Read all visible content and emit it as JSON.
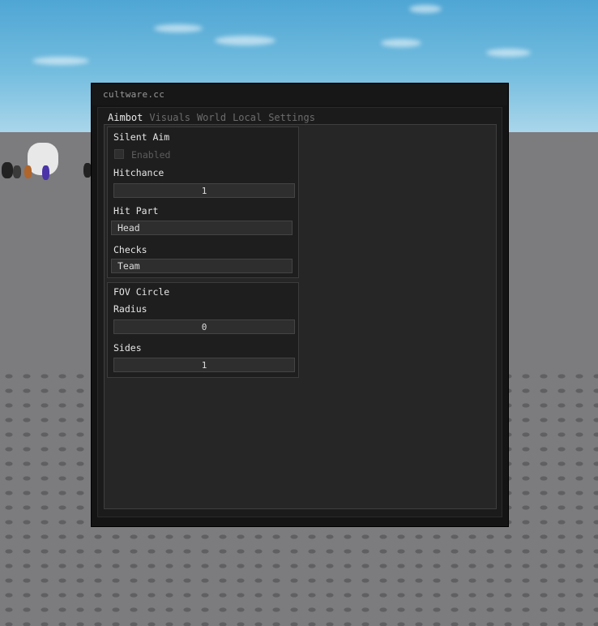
{
  "window": {
    "title": "cultware.cc"
  },
  "tabs": [
    {
      "label": "Aimbot",
      "active": true
    },
    {
      "label": "Visuals",
      "active": false
    },
    {
      "label": "World",
      "active": false
    },
    {
      "label": "Local",
      "active": false
    },
    {
      "label": "Settings",
      "active": false
    }
  ],
  "silent_aim": {
    "title": "Silent Aim",
    "enabled_label": "Enabled",
    "enabled": false,
    "hitchance_label": "Hitchance",
    "hitchance_value": "1",
    "hit_part_label": "Hit Part",
    "hit_part_value": "Head",
    "checks_label": "Checks",
    "checks_value": "Team"
  },
  "fov_circle": {
    "title": "FOV Circle",
    "radius_label": "Radius",
    "radius_value": "0",
    "sides_label": "Sides",
    "sides_value": "1"
  },
  "colors": {
    "accent_text": "#e6e6e6",
    "inactive_text": "#6c6c6c",
    "window_bg": "#141414"
  }
}
